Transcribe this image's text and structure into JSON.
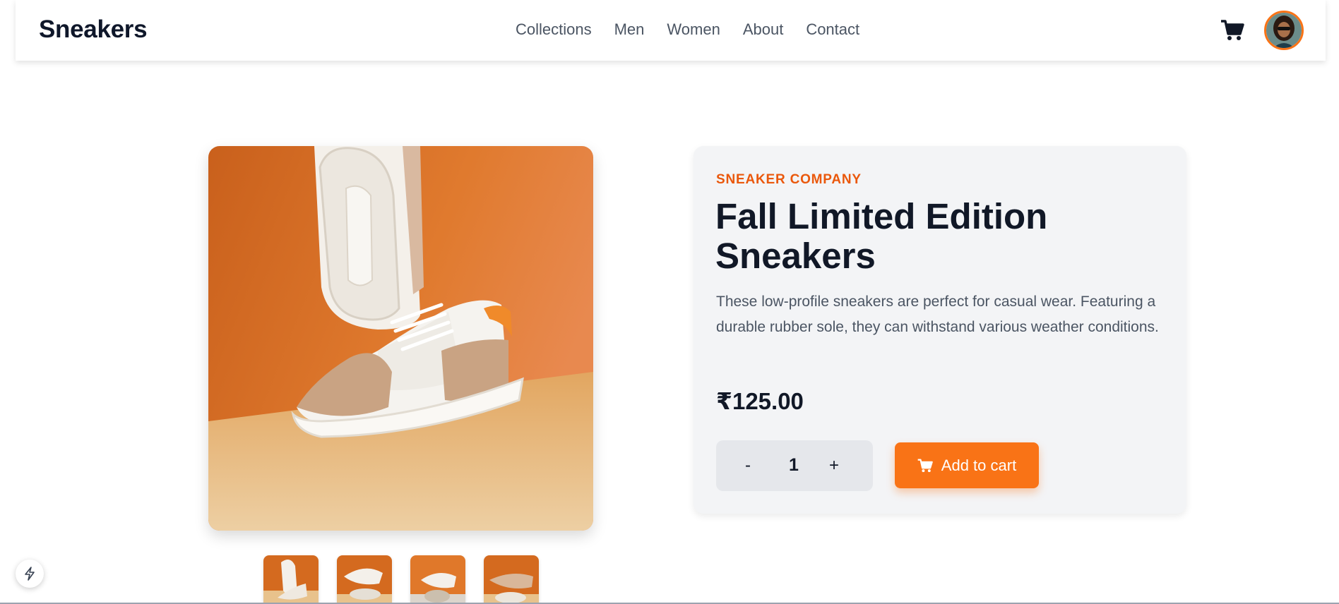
{
  "header": {
    "logo": "Sneakers",
    "nav": [
      "Collections",
      "Men",
      "Women",
      "About",
      "Contact"
    ],
    "cart_icon": "cart-icon",
    "avatar_icon": "user-avatar"
  },
  "product": {
    "company": "SNEAKER COMPANY",
    "title": "Fall Limited Edition Sneakers",
    "description": "These low-profile sneakers are perfect for casual wear. Featuring a durable rubber sole, they can withstand various weather conditions.",
    "price": "₹125.00",
    "quantity": "1",
    "minus_label": "-",
    "plus_label": "+",
    "add_to_cart_label": "Add to cart"
  },
  "gallery": {
    "thumbnail_count": 4
  },
  "colors": {
    "accent": "#f97316",
    "accent_text": "#ea580c",
    "card_bg": "#f3f4f6"
  }
}
